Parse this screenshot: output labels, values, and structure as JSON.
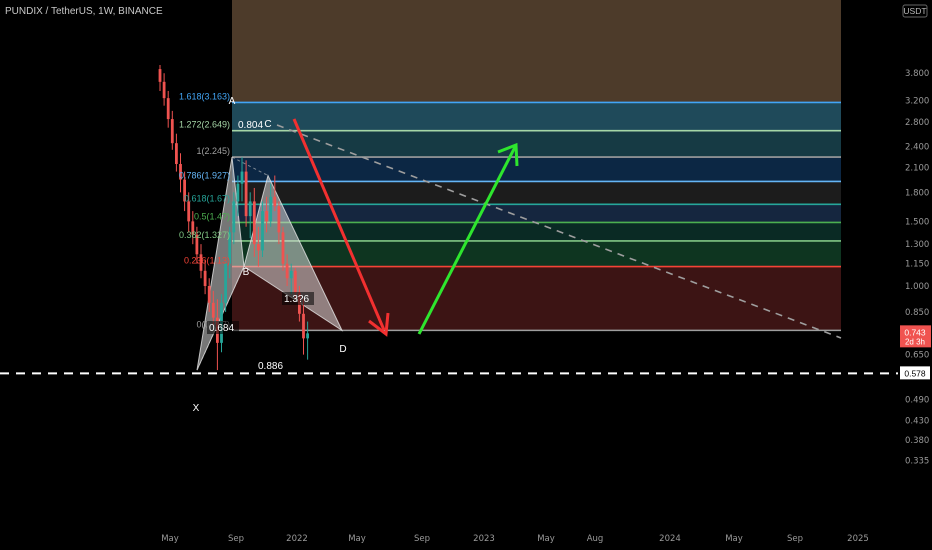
{
  "header": {
    "title": "PUNDIX / TetherUS, 1W, BINANCE",
    "currency": "USDT"
  },
  "chart_data": {
    "type": "candlestick",
    "symbol": "PUNDIX / TetherUS",
    "interval": "1W",
    "exchange": "BINANCE",
    "y_scale": "log",
    "ylim": [
      0.32,
      4.0
    ],
    "y_ticks": [
      "3.800",
      "3.200",
      "2.800",
      "2.400",
      "2.100",
      "1.800",
      "1.500",
      "1.300",
      "1.150",
      "1.000",
      "0.850",
      "0.750",
      "0.650",
      "0.570",
      "0.490",
      "0.430",
      "0.380",
      "0.335"
    ],
    "x_ticks": [
      "May",
      "Sep",
      "2022",
      "May",
      "Sep",
      "2023",
      "May",
      "Aug",
      "2024",
      "May",
      "Sep",
      "2025"
    ],
    "current_price": {
      "value": "0.743",
      "countdown": "2d 3h",
      "color": "#f05350"
    },
    "horizontal_line": {
      "value": "0.578",
      "style": "dashed",
      "color": "#ffffff"
    },
    "fib_levels": [
      {
        "label": "1.618(3.163)",
        "price": 3.163,
        "color": "#42a5f5",
        "zone": "#1f4a5a"
      },
      {
        "label": "1.272(2.649)",
        "price": 2.649,
        "color": "#a5d6a7",
        "zone": "#163a44"
      },
      {
        "label": "1(2.245)",
        "price": 2.245,
        "color": "#9e9e9e",
        "zone": "#0c2744"
      },
      {
        "label": "0.786(1.927)",
        "price": 1.927,
        "color": "#64b5f6",
        "zone": "#1c1c1c"
      },
      {
        "label": "0.618(1.67)",
        "price": 1.67,
        "color": "#26a69a",
        "zone": "#15263f"
      },
      {
        "label": "0.5(1.4?)",
        "price": 1.49,
        "color": "#4caf50",
        "zone": "#0a2a24"
      },
      {
        "label": "0.382(1.327)",
        "price": 1.327,
        "color": "#81c784",
        "zone": "#0e3520"
      },
      {
        "label": "0.236(1.13)",
        "price": 1.13,
        "color": "#f44336",
        "zone": "#1d3322"
      },
      {
        "label": "0(0.757)",
        "price": 0.757,
        "color": "#9e9e9e",
        "zone": "#3c1414"
      }
    ],
    "top_zone_color": "#4d3b2a",
    "pattern": {
      "type": "harmonic",
      "points": [
        {
          "name": "X",
          "price": 0.59
        },
        {
          "name": "A",
          "price": 2.245
        },
        {
          "name": "B",
          "price": 1.13
        },
        {
          "name": "C",
          "price": 2.0
        },
        {
          "name": "D",
          "price": 0.757
        }
      ],
      "ratios": [
        {
          "label": "0.804"
        },
        {
          "label": "0.684"
        },
        {
          "label": "1.3?6"
        },
        {
          "label": "0.886"
        }
      ]
    },
    "arrows": [
      {
        "direction": "down",
        "color": "#f23030"
      },
      {
        "direction": "up",
        "color": "#2ee62e"
      }
    ],
    "trendline": {
      "style": "dashed",
      "color": "#9e9e9e"
    },
    "candles": [
      {
        "o": 3.9,
        "h": 4.0,
        "l": 3.4,
        "c": 3.6
      },
      {
        "o": 3.6,
        "h": 3.8,
        "l": 3.1,
        "c": 3.25
      },
      {
        "o": 3.25,
        "h": 3.4,
        "l": 2.7,
        "c": 2.85
      },
      {
        "o": 2.85,
        "h": 3.0,
        "l": 2.35,
        "c": 2.45
      },
      {
        "o": 2.45,
        "h": 2.6,
        "l": 2.05,
        "c": 2.15
      },
      {
        "o": 2.15,
        "h": 2.3,
        "l": 1.8,
        "c": 1.95
      },
      {
        "o": 1.95,
        "h": 2.05,
        "l": 1.6,
        "c": 1.7
      },
      {
        "o": 1.7,
        "h": 1.8,
        "l": 1.4,
        "c": 1.5
      },
      {
        "o": 1.5,
        "h": 1.6,
        "l": 1.3,
        "c": 1.38
      },
      {
        "o": 1.38,
        "h": 1.45,
        "l": 1.15,
        "c": 1.22
      },
      {
        "o": 1.22,
        "h": 1.3,
        "l": 1.05,
        "c": 1.1
      },
      {
        "o": 1.1,
        "h": 1.18,
        "l": 0.95,
        "c": 1.0
      },
      {
        "o": 1.0,
        "h": 1.05,
        "l": 0.85,
        "c": 0.9
      },
      {
        "o": 0.9,
        "h": 0.97,
        "l": 0.78,
        "c": 0.82
      },
      {
        "o": 0.82,
        "h": 0.92,
        "l": 0.59,
        "c": 0.7
      },
      {
        "o": 0.7,
        "h": 0.95,
        "l": 0.66,
        "c": 0.9
      },
      {
        "o": 0.9,
        "h": 1.2,
        "l": 0.85,
        "c": 1.15
      },
      {
        "o": 1.15,
        "h": 1.45,
        "l": 1.05,
        "c": 1.4
      },
      {
        "o": 1.4,
        "h": 1.8,
        "l": 1.3,
        "c": 1.7
      },
      {
        "o": 1.7,
        "h": 2.0,
        "l": 1.55,
        "c": 1.9
      },
      {
        "o": 1.9,
        "h": 2.245,
        "l": 1.7,
        "c": 2.05
      },
      {
        "o": 2.05,
        "h": 2.2,
        "l": 1.45,
        "c": 1.55
      },
      {
        "o": 1.55,
        "h": 1.8,
        "l": 1.35,
        "c": 1.7
      },
      {
        "o": 1.7,
        "h": 1.85,
        "l": 1.2,
        "c": 1.3
      },
      {
        "o": 1.3,
        "h": 1.45,
        "l": 1.13,
        "c": 1.25
      },
      {
        "o": 1.25,
        "h": 1.7,
        "l": 1.2,
        "c": 1.6
      },
      {
        "o": 1.6,
        "h": 1.75,
        "l": 1.4,
        "c": 1.5
      },
      {
        "o": 1.5,
        "h": 1.9,
        "l": 1.45,
        "c": 1.75
      },
      {
        "o": 1.75,
        "h": 2.0,
        "l": 1.6,
        "c": 1.65
      },
      {
        "o": 1.65,
        "h": 1.7,
        "l": 1.3,
        "c": 1.4
      },
      {
        "o": 1.4,
        "h": 1.45,
        "l": 1.1,
        "c": 1.15
      },
      {
        "o": 1.15,
        "h": 1.22,
        "l": 1.0,
        "c": 1.05
      },
      {
        "o": 1.05,
        "h": 1.15,
        "l": 0.95,
        "c": 1.1
      },
      {
        "o": 1.1,
        "h": 1.12,
        "l": 0.92,
        "c": 0.96
      },
      {
        "o": 0.96,
        "h": 1.0,
        "l": 0.8,
        "c": 0.84
      },
      {
        "o": 0.84,
        "h": 0.92,
        "l": 0.65,
        "c": 0.72
      },
      {
        "o": 0.72,
        "h": 0.8,
        "l": 0.63,
        "c": 0.743
      }
    ]
  }
}
